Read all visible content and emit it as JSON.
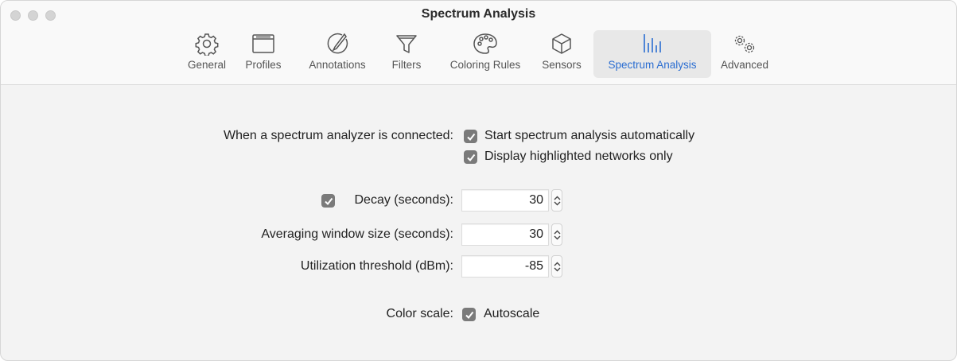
{
  "window": {
    "title": "Spectrum Analysis"
  },
  "toolbar": {
    "tabs": [
      {
        "label": "General",
        "icon": "gear-icon"
      },
      {
        "label": "Profiles",
        "icon": "window-icon"
      },
      {
        "label": "Annotations",
        "icon": "annotation-icon"
      },
      {
        "label": "Filters",
        "icon": "funnel-icon"
      },
      {
        "label": "Coloring Rules",
        "icon": "palette-icon"
      },
      {
        "label": "Sensors",
        "icon": "cube-icon"
      },
      {
        "label": "Spectrum Analysis",
        "icon": "spectrum-bars-icon",
        "active": true
      },
      {
        "label": "Advanced",
        "icon": "gears-icon"
      }
    ],
    "accent_color": "#2a6dd1"
  },
  "settings": {
    "connected_label": "When a spectrum analyzer is connected:",
    "start_auto": {
      "label": "Start spectrum analysis automatically",
      "checked": true
    },
    "display_highlighted": {
      "label": "Display highlighted networks only",
      "checked": true
    },
    "decay": {
      "label": "Decay (seconds):",
      "checked": true,
      "value": "30"
    },
    "averaging": {
      "label": "Averaging window size (seconds):",
      "value": "30"
    },
    "utilization": {
      "label": "Utilization threshold (dBm):",
      "value": "-85"
    },
    "color_scale": {
      "label": "Color scale:",
      "autoscale_label": "Autoscale",
      "checked": true
    }
  }
}
